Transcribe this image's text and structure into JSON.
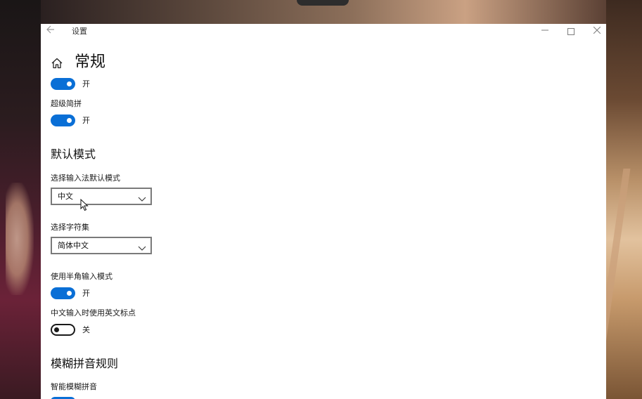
{
  "window": {
    "title": "设置",
    "back_icon": "back-arrow-icon",
    "controls": {
      "minimize": "—",
      "close": "✕"
    }
  },
  "page": {
    "icon": "home-icon",
    "title": "常规"
  },
  "settings": {
    "top_toggle": {
      "state": "开",
      "on": true
    },
    "super_jianpin": {
      "label": "超级简拼",
      "state": "开",
      "on": true
    },
    "default_mode_heading": "默认模式",
    "input_default_mode": {
      "label": "选择输入法默认模式",
      "value": "中文"
    },
    "charset": {
      "label": "选择字符集",
      "value": "简体中文"
    },
    "half_width": {
      "label": "使用半角输入模式",
      "state": "开",
      "on": true
    },
    "english_punct": {
      "label": "中文输入时使用英文标点",
      "state": "关",
      "on": false
    },
    "fuzzy_heading": "模糊拼音规则",
    "smart_fuzzy": {
      "label": "智能模糊拼音"
    }
  },
  "colors": {
    "accent": "#0a6fd6",
    "window_bg": "#ffffff",
    "text": "#1a1a1a"
  }
}
